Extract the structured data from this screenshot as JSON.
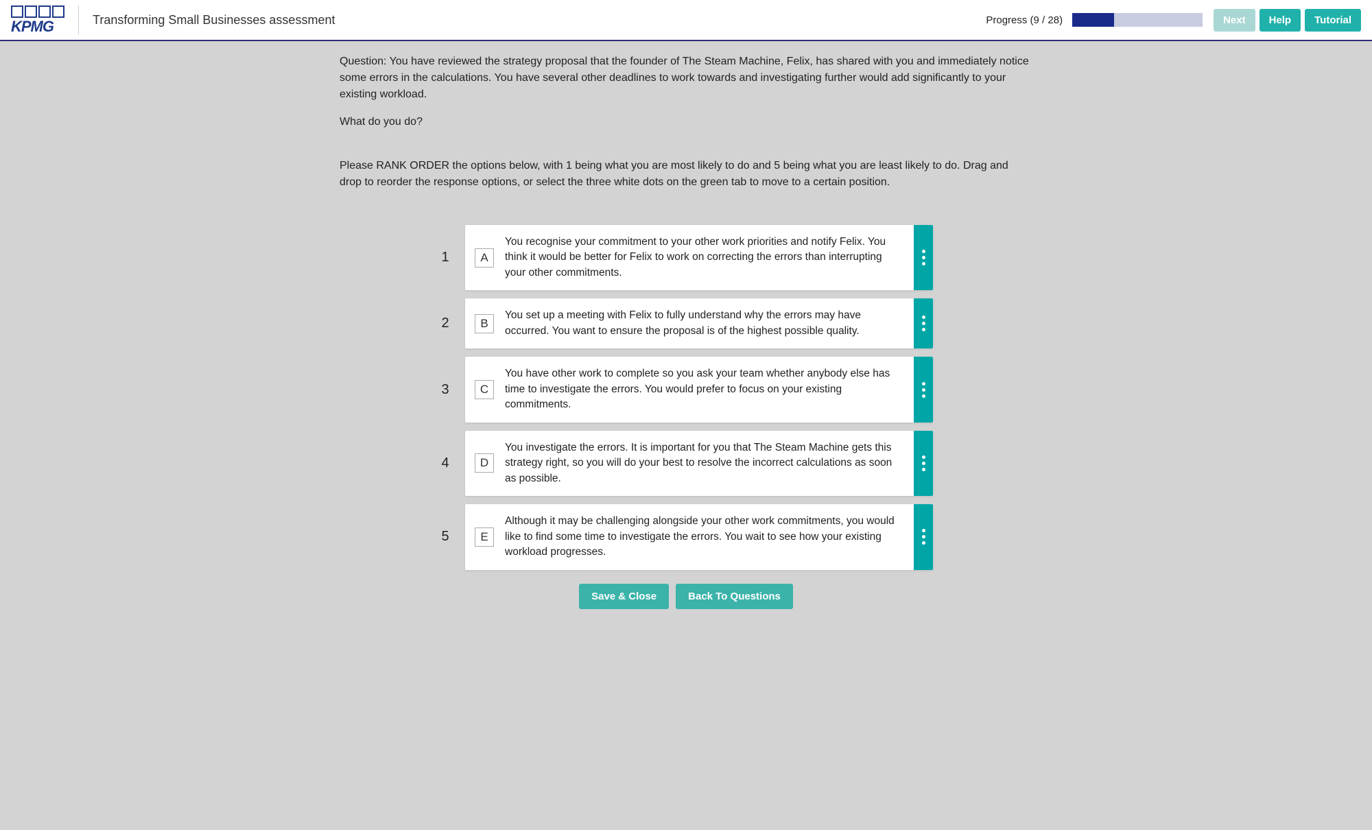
{
  "header": {
    "logo_text": "KPMG",
    "title": "Transforming Small Businesses assessment",
    "progress_label": "Progress (9 / 28)",
    "progress_percent": 32,
    "next": "Next",
    "help": "Help",
    "tutorial": "Tutorial"
  },
  "question": {
    "text": "Question: You have reviewed the strategy proposal that the founder of The Steam Machine, Felix, has shared with you and immediately notice some errors in the calculations. You have several other deadlines to work towards and investigating further would add significantly to your existing workload.",
    "prompt": "What do you do?",
    "instructions": "Please RANK ORDER the options below, with 1 being what you are most likely to do and 5 being what you are least likely to do. Drag and drop to reorder the response options, or select the three white dots on the green tab to move to a certain position."
  },
  "options": [
    {
      "rank": "1",
      "letter": "A",
      "text": "You recognise your commitment to your other work priorities and notify Felix. You think it would be better for Felix to work on correcting the errors than interrupting your other commitments."
    },
    {
      "rank": "2",
      "letter": "B",
      "text": "You set up a meeting with Felix to fully understand why the errors may have occurred. You want to ensure the proposal is of the highest possible quality."
    },
    {
      "rank": "3",
      "letter": "C",
      "text": "You have other work to complete so you ask your team whether anybody else has time to investigate the errors. You would prefer to focus on your existing commitments."
    },
    {
      "rank": "4",
      "letter": "D",
      "text": "You investigate the errors. It is important for you that The Steam Machine gets this strategy right, so you will do your best to resolve the incorrect calculations as soon as possible."
    },
    {
      "rank": "5",
      "letter": "E",
      "text": "Although it may be challenging alongside your other work commitments, you would like to find some time to investigate the errors. You wait to see how your existing workload progresses."
    }
  ],
  "footer": {
    "save": "Save & Close",
    "back": "Back To Questions"
  }
}
